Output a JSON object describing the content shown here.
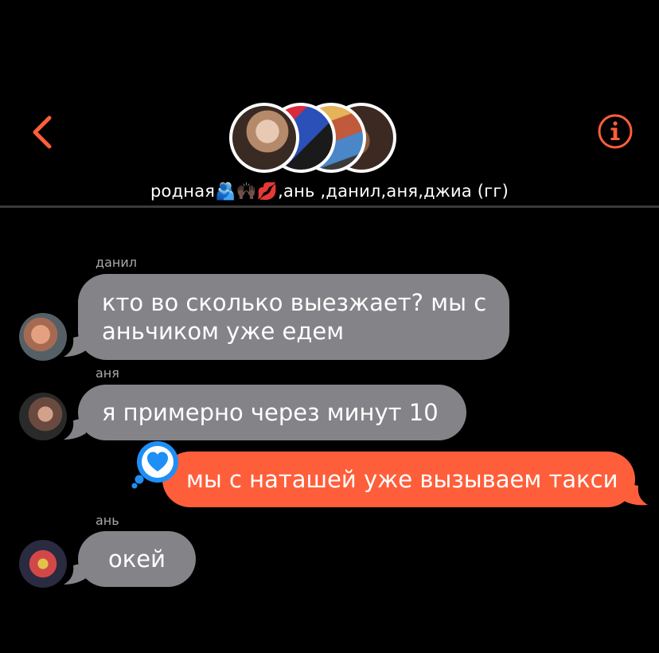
{
  "header": {
    "back_icon": "chevron-left-icon",
    "info_icon": "info-icon",
    "accent_color": "#ff5e3a",
    "group_title": "родная🫂🙌🏿💋,ань ,данил,аня,джиа (гг)"
  },
  "messages": [
    {
      "sender": "данил",
      "text_line1": "кто во сколько выезжает? мы с",
      "text_line2": "аньчиком уже едем",
      "direction": "incoming"
    },
    {
      "sender": "аня",
      "text": "я примерно через минут 10",
      "direction": "incoming"
    },
    {
      "sender": "",
      "text": "мы с наташей уже вызываем такси",
      "direction": "outgoing",
      "reaction": "heart-icon"
    },
    {
      "sender": "ань",
      "text": "окей",
      "direction": "incoming"
    }
  ],
  "colors": {
    "incoming_bubble": "#848387",
    "outgoing_bubble": "#ff5e3a",
    "reaction": "#1e8ff6"
  }
}
